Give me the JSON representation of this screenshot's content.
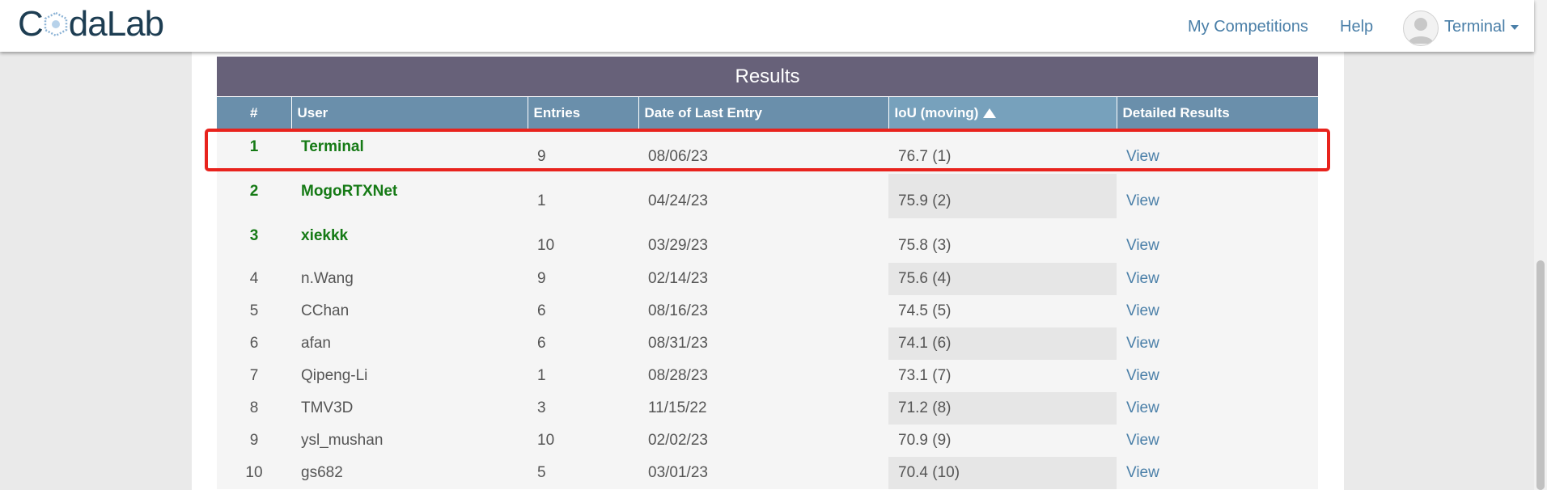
{
  "navbar": {
    "logo_before": "C",
    "logo_after": "daLab",
    "links": [
      "My Competitions",
      "Help"
    ],
    "user": "Terminal"
  },
  "results": {
    "title": "Results",
    "columns": [
      "#",
      "User",
      "Entries",
      "Date of Last Entry",
      "IoU (moving)",
      "Detailed Results"
    ],
    "sort_column": "IoU (moving)",
    "highlighted_row": 1,
    "rows": [
      {
        "rank": "1",
        "user": "Terminal",
        "entries": "9",
        "date": "08/06/23",
        "score": "76.7 (1)",
        "details": "View"
      },
      {
        "rank": "2",
        "user": "MogoRTXNet",
        "entries": "1",
        "date": "04/24/23",
        "score": "75.9 (2)",
        "details": "View"
      },
      {
        "rank": "3",
        "user": "xiekkk",
        "entries": "10",
        "date": "03/29/23",
        "score": "75.8 (3)",
        "details": "View"
      },
      {
        "rank": "4",
        "user": "n.Wang",
        "entries": "9",
        "date": "02/14/23",
        "score": "75.6 (4)",
        "details": "View"
      },
      {
        "rank": "5",
        "user": "CChan",
        "entries": "6",
        "date": "08/16/23",
        "score": "74.5 (5)",
        "details": "View"
      },
      {
        "rank": "6",
        "user": "afan",
        "entries": "6",
        "date": "08/31/23",
        "score": "74.1 (6)",
        "details": "View"
      },
      {
        "rank": "7",
        "user": "Qipeng-Li",
        "entries": "1",
        "date": "08/28/23",
        "score": "73.1 (7)",
        "details": "View"
      },
      {
        "rank": "8",
        "user": "TMV3D",
        "entries": "3",
        "date": "11/15/22",
        "score": "71.2 (8)",
        "details": "View"
      },
      {
        "rank": "9",
        "user": "ysl_mushan",
        "entries": "10",
        "date": "02/02/23",
        "score": "70.9 (9)",
        "details": "View"
      },
      {
        "rank": "10",
        "user": "gs682",
        "entries": "5",
        "date": "03/01/23",
        "score": "70.4 (10)",
        "details": "View"
      }
    ]
  },
  "colors": {
    "header_bar": "#676179",
    "column_header": "#6a8fab",
    "top_rank_text": "#157a15",
    "link": "#4a7fa8",
    "highlight": "#e8231d"
  }
}
